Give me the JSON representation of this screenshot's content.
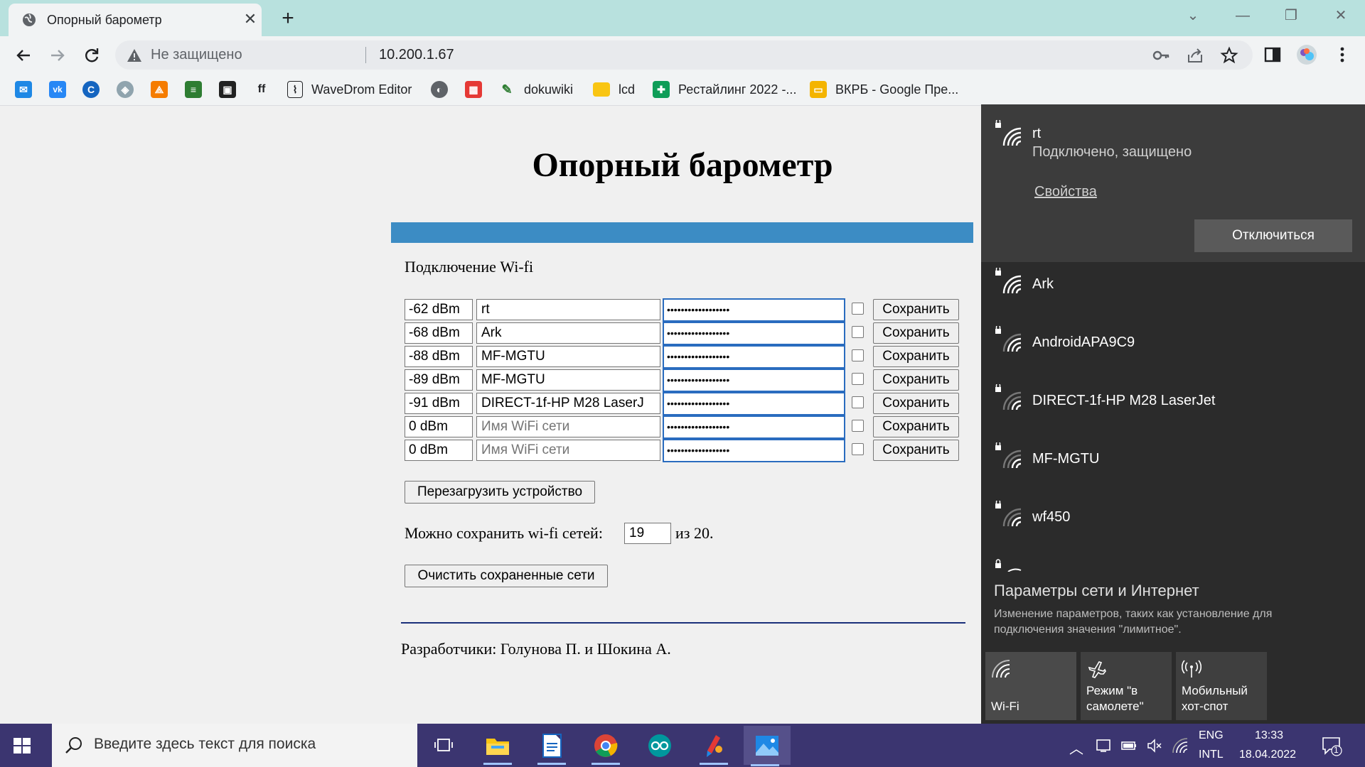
{
  "browser": {
    "tab_title": "Опорный барометр",
    "not_secure_label": "Не защищено",
    "url": "10.200.1.67"
  },
  "bookmarks": [
    {
      "icon": "mail-icon",
      "label": ""
    },
    {
      "icon": "vk-icon",
      "label": ""
    },
    {
      "icon": "c-icon",
      "label": ""
    },
    {
      "icon": "emblem-icon",
      "label": ""
    },
    {
      "icon": "diagram-icon",
      "label": ""
    },
    {
      "icon": "stack-icon",
      "label": ""
    },
    {
      "icon": "chip-icon",
      "label": ""
    },
    {
      "icon": "ff-icon",
      "label": ""
    },
    {
      "icon": "wavedrom-icon",
      "label": "WaveDrom Editor"
    },
    {
      "icon": "globe-icon",
      "label": ""
    },
    {
      "icon": "calendar-icon",
      "label": ""
    },
    {
      "icon": "dokuwiki-icon",
      "label": "dokuwiki"
    },
    {
      "icon": "folder-icon",
      "label": "lcd"
    },
    {
      "icon": "sheets-icon",
      "label": "Рестайлинг 2022 -..."
    },
    {
      "icon": "slides-icon",
      "label": "ВКРБ - Google Пре..."
    }
  ],
  "page": {
    "title": "Опорный барометр",
    "section_label": "Подключение Wi-fi",
    "networks": [
      {
        "rssi": "-62 dBm",
        "ssid": "rt",
        "placeholder": false,
        "password": "••••••••••••••••••",
        "save": "Сохранить"
      },
      {
        "rssi": "-68 dBm",
        "ssid": "Ark",
        "placeholder": false,
        "password": "••••••••••••••••••",
        "save": "Сохранить"
      },
      {
        "rssi": "-88 dBm",
        "ssid": "MF-MGTU",
        "placeholder": false,
        "password": "••••••••••••••••••",
        "save": "Сохранить"
      },
      {
        "rssi": "-89 dBm",
        "ssid": "MF-MGTU",
        "placeholder": false,
        "password": "••••••••••••••••••",
        "save": "Сохранить"
      },
      {
        "rssi": "-91 dBm",
        "ssid": "DIRECT-1f-HP M28 LaserJ",
        "placeholder": false,
        "password": "••••••••••••••••••",
        "save": "Сохранить"
      },
      {
        "rssi": "0 dBm",
        "ssid": "Имя WiFi сети",
        "placeholder": true,
        "password": "••••••••••••••••••",
        "save": "Сохранить"
      },
      {
        "rssi": "0 dBm",
        "ssid": "Имя WiFi сети",
        "placeholder": true,
        "password": "••••••••••••••••••",
        "save": "Сохранить"
      }
    ],
    "reboot_button": "Перезагрузить устройство",
    "count_label": "Можно сохранить wi-fi сетей:",
    "count_value": "19",
    "count_suffix": "из 20.",
    "clear_button": "Очистить сохраненные сети",
    "developers": "Разработчики: Голунова П. и Шокина А."
  },
  "flyout": {
    "connected": {
      "name": "rt",
      "status": "Подключено, защищено",
      "properties": "Свойства",
      "disconnect": "Отключиться"
    },
    "networks": [
      "Ark",
      "AndroidAPA9C9",
      "DIRECT-1f-HP M28 LaserJet",
      "MF-MGTU",
      "wf450"
    ],
    "settings_title": "Параметры сети и Интернет",
    "settings_desc": "Изменение параметров, таких как установление для подключения значения \"лимитное\".",
    "quick_actions": [
      {
        "icon": "wifi-icon",
        "label": "Wi-Fi"
      },
      {
        "icon": "airplane-icon",
        "label": "Режим \"в самолете\""
      },
      {
        "icon": "hotspot-icon",
        "label": "Мобильный хот-спот"
      }
    ]
  },
  "taskbar": {
    "search_placeholder": "Введите здесь текст для поиска",
    "lang_top": "ENG",
    "lang_bottom": "INTL",
    "time": "13:33",
    "date": "18.04.2022",
    "notification_count": "1"
  },
  "colors": {
    "tabstrip": "#b8e1de",
    "blue_bar": "#3c8cc4",
    "taskbar": "#3b3570",
    "flyout_bg": "#2b2b2b"
  }
}
